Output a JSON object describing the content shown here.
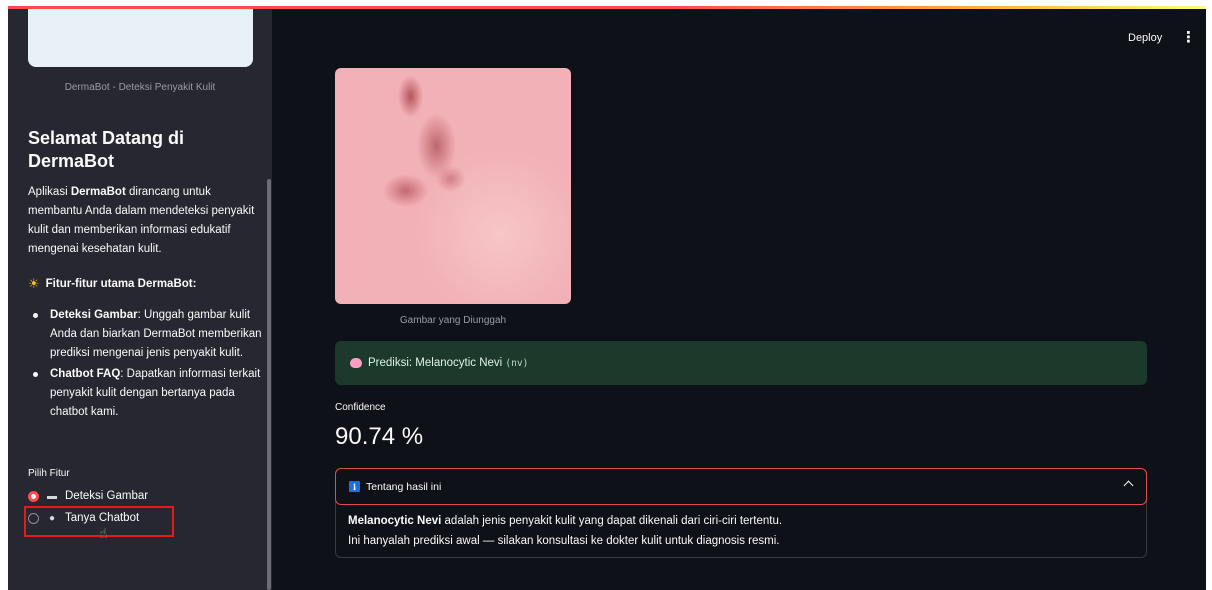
{
  "sidebar": {
    "logo_caption": "DermaBot - Deteksi Penyakit Kulit",
    "welcome_title": "Selamat Datang di DermaBot",
    "intro": {
      "before": "Aplikasi ",
      "bold": "DermaBot",
      "after": " dirancang untuk membantu Anda dalam mendeteksi penyakit kulit dan memberikan informasi edukatif mengenai kesehatan kulit."
    },
    "features_title": "Fitur-fitur utama DermaBot:",
    "features_icon": "sun-icon",
    "features": [
      {
        "bold": "Deteksi Gambar",
        "text": ": Unggah gambar kulit Anda dan biarkan DermaBot memberikan prediksi mengenai jenis penyakit kulit."
      },
      {
        "bold": "Chatbot FAQ",
        "text": ": Dapatkan informasi terkait penyakit kulit dengan bertanya pada chatbot kami."
      }
    ],
    "radio_label": "Pilih Fitur",
    "radio_options": [
      {
        "label": "Deteksi Gambar",
        "icon": "folder-icon",
        "selected": true
      },
      {
        "label": "Tanya Chatbot",
        "icon": "speech-bubble-icon",
        "selected": false
      }
    ]
  },
  "header": {
    "deploy_label": "Deploy",
    "menu_icon": "more-vertical-icon"
  },
  "main": {
    "image_caption": "Gambar yang Diunggah",
    "prediction": {
      "prefix": "Prediksi: Melanocytic Nevi ",
      "code": "(nv)",
      "icon": "brain-icon"
    },
    "confidence": {
      "label": "Confidence",
      "value": "90.74 %"
    },
    "expander": {
      "title": "Tentang hasil ini",
      "icon": "info-icon",
      "body_bold": "Melanocytic Nevi",
      "body_line1": " adalah jenis penyakit kulit yang dapat dikenali dari ciri-ciri tertentu.",
      "body_line2": "Ini hanyalah prediksi awal — silakan konsultasi ke dokter kulit untuk diagnosis resmi."
    }
  },
  "colors": {
    "background": "#0e1117",
    "sidebar": "#262730",
    "accent": "#ff4b4b",
    "success_bg": "#1b3a2b",
    "info": "#1e6fd9"
  }
}
